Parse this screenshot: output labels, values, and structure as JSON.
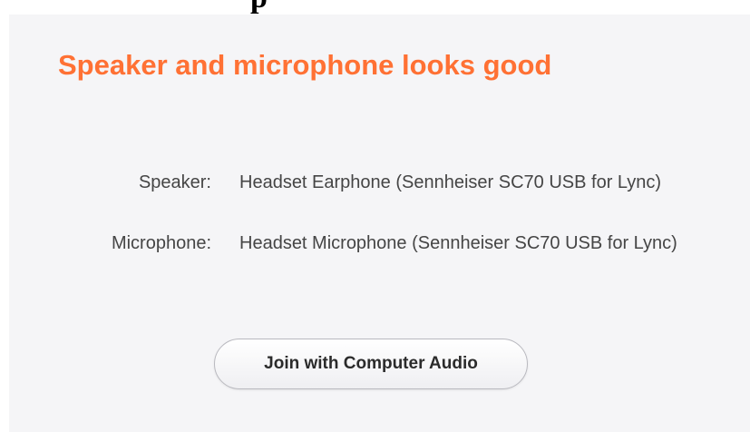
{
  "top_fragment": "p",
  "dialog": {
    "title": "Speaker and microphone looks good",
    "speaker": {
      "label": "Speaker:",
      "value": "Headset Earphone (Sennheiser SC70 USB for Lync)"
    },
    "microphone": {
      "label": "Microphone:",
      "value": "Headset Microphone (Sennheiser SC70 USB for Lync)"
    },
    "join_button_label": "Join with Computer Audio"
  },
  "colors": {
    "title": "#ff7134",
    "panel_background": "#f5f5f7",
    "text": "#454545"
  }
}
